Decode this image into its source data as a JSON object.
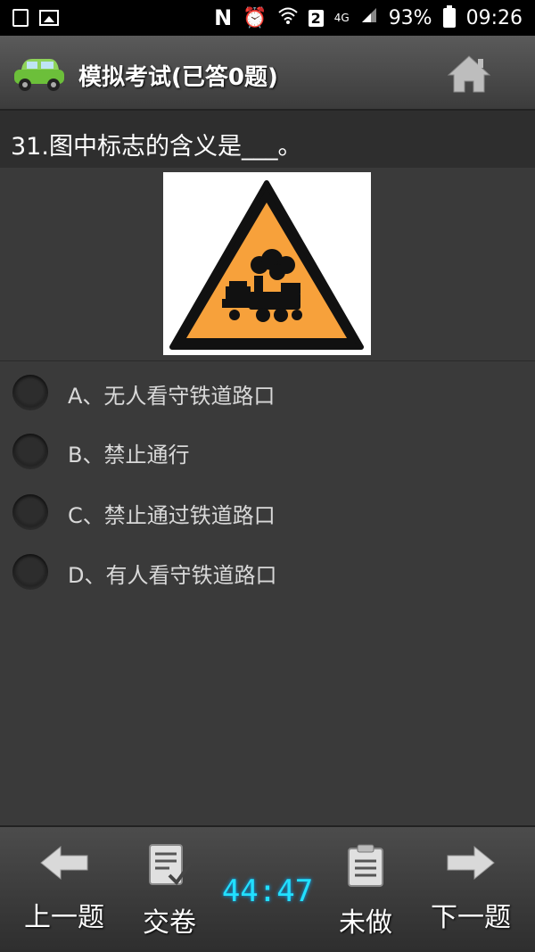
{
  "status_bar": {
    "signal_label": "4G",
    "sim_badge": "2",
    "battery": "93%",
    "time": "09:26"
  },
  "header": {
    "title": "模拟考试(已答0题)"
  },
  "question": {
    "text": "31.图中标志的含义是___。",
    "image_icon": "railway-crossing-warning-sign"
  },
  "options": [
    {
      "label": "A、无人看守铁道路口"
    },
    {
      "label": "B、禁止通行"
    },
    {
      "label": "C、禁止通过铁道路口"
    },
    {
      "label": "D、有人看守铁道路口"
    }
  ],
  "footer": {
    "prev_label": "上一题",
    "submit_label": "交卷",
    "timer": "44:47",
    "unanswered_label": "未做",
    "next_label": "下一题"
  },
  "colors": {
    "timer": "#22e0ff",
    "sign_fill": "#f7a13b",
    "car_body": "#6cbf3a"
  }
}
